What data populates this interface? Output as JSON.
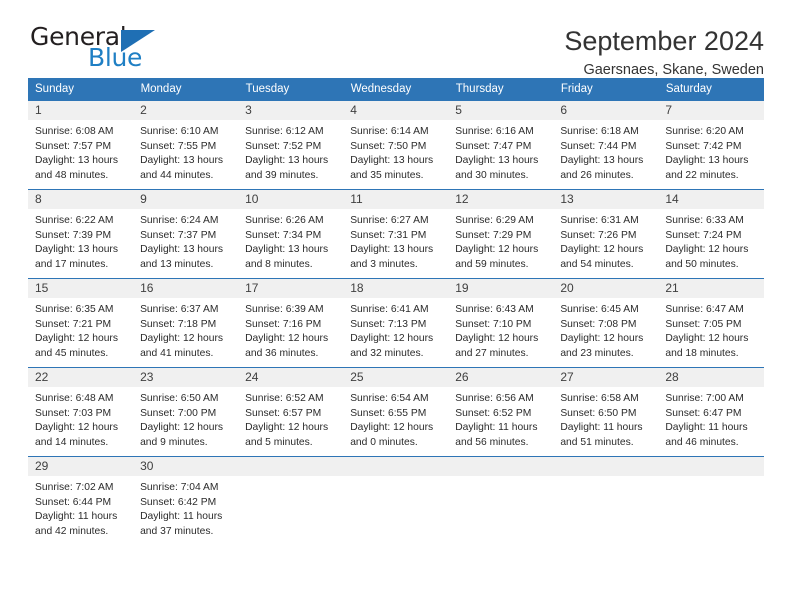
{
  "logo": {
    "word_top": "General",
    "word_bottom": "Blue",
    "triangle_color": "#1f6fb4",
    "top_color": "#231f20",
    "bottom_color": "#1f7fc4"
  },
  "header": {
    "title": "September 2024",
    "subtitle": "Gaersnaes, Skane, Sweden"
  },
  "theme": {
    "header_bg": "#2e75b6",
    "header_text": "#ffffff",
    "daynum_bg": "#f0f0f0",
    "grid_line": "#2e75b6"
  },
  "weekday_headers": [
    "Sunday",
    "Monday",
    "Tuesday",
    "Wednesday",
    "Thursday",
    "Friday",
    "Saturday"
  ],
  "labels": {
    "sunrise": "Sunrise:",
    "sunset": "Sunset:",
    "daylight": "Daylight:"
  },
  "weeks": [
    [
      {
        "day": "1",
        "sunrise": "Sunrise: 6:08 AM",
        "sunset": "Sunset: 7:57 PM",
        "daylight_line1": "Daylight: 13 hours",
        "daylight_line2": "and 48 minutes."
      },
      {
        "day": "2",
        "sunrise": "Sunrise: 6:10 AM",
        "sunset": "Sunset: 7:55 PM",
        "daylight_line1": "Daylight: 13 hours",
        "daylight_line2": "and 44 minutes."
      },
      {
        "day": "3",
        "sunrise": "Sunrise: 6:12 AM",
        "sunset": "Sunset: 7:52 PM",
        "daylight_line1": "Daylight: 13 hours",
        "daylight_line2": "and 39 minutes."
      },
      {
        "day": "4",
        "sunrise": "Sunrise: 6:14 AM",
        "sunset": "Sunset: 7:50 PM",
        "daylight_line1": "Daylight: 13 hours",
        "daylight_line2": "and 35 minutes."
      },
      {
        "day": "5",
        "sunrise": "Sunrise: 6:16 AM",
        "sunset": "Sunset: 7:47 PM",
        "daylight_line1": "Daylight: 13 hours",
        "daylight_line2": "and 30 minutes."
      },
      {
        "day": "6",
        "sunrise": "Sunrise: 6:18 AM",
        "sunset": "Sunset: 7:44 PM",
        "daylight_line1": "Daylight: 13 hours",
        "daylight_line2": "and 26 minutes."
      },
      {
        "day": "7",
        "sunrise": "Sunrise: 6:20 AM",
        "sunset": "Sunset: 7:42 PM",
        "daylight_line1": "Daylight: 13 hours",
        "daylight_line2": "and 22 minutes."
      }
    ],
    [
      {
        "day": "8",
        "sunrise": "Sunrise: 6:22 AM",
        "sunset": "Sunset: 7:39 PM",
        "daylight_line1": "Daylight: 13 hours",
        "daylight_line2": "and 17 minutes."
      },
      {
        "day": "9",
        "sunrise": "Sunrise: 6:24 AM",
        "sunset": "Sunset: 7:37 PM",
        "daylight_line1": "Daylight: 13 hours",
        "daylight_line2": "and 13 minutes."
      },
      {
        "day": "10",
        "sunrise": "Sunrise: 6:26 AM",
        "sunset": "Sunset: 7:34 PM",
        "daylight_line1": "Daylight: 13 hours",
        "daylight_line2": "and 8 minutes."
      },
      {
        "day": "11",
        "sunrise": "Sunrise: 6:27 AM",
        "sunset": "Sunset: 7:31 PM",
        "daylight_line1": "Daylight: 13 hours",
        "daylight_line2": "and 3 minutes."
      },
      {
        "day": "12",
        "sunrise": "Sunrise: 6:29 AM",
        "sunset": "Sunset: 7:29 PM",
        "daylight_line1": "Daylight: 12 hours",
        "daylight_line2": "and 59 minutes."
      },
      {
        "day": "13",
        "sunrise": "Sunrise: 6:31 AM",
        "sunset": "Sunset: 7:26 PM",
        "daylight_line1": "Daylight: 12 hours",
        "daylight_line2": "and 54 minutes."
      },
      {
        "day": "14",
        "sunrise": "Sunrise: 6:33 AM",
        "sunset": "Sunset: 7:24 PM",
        "daylight_line1": "Daylight: 12 hours",
        "daylight_line2": "and 50 minutes."
      }
    ],
    [
      {
        "day": "15",
        "sunrise": "Sunrise: 6:35 AM",
        "sunset": "Sunset: 7:21 PM",
        "daylight_line1": "Daylight: 12 hours",
        "daylight_line2": "and 45 minutes."
      },
      {
        "day": "16",
        "sunrise": "Sunrise: 6:37 AM",
        "sunset": "Sunset: 7:18 PM",
        "daylight_line1": "Daylight: 12 hours",
        "daylight_line2": "and 41 minutes."
      },
      {
        "day": "17",
        "sunrise": "Sunrise: 6:39 AM",
        "sunset": "Sunset: 7:16 PM",
        "daylight_line1": "Daylight: 12 hours",
        "daylight_line2": "and 36 minutes."
      },
      {
        "day": "18",
        "sunrise": "Sunrise: 6:41 AM",
        "sunset": "Sunset: 7:13 PM",
        "daylight_line1": "Daylight: 12 hours",
        "daylight_line2": "and 32 minutes."
      },
      {
        "day": "19",
        "sunrise": "Sunrise: 6:43 AM",
        "sunset": "Sunset: 7:10 PM",
        "daylight_line1": "Daylight: 12 hours",
        "daylight_line2": "and 27 minutes."
      },
      {
        "day": "20",
        "sunrise": "Sunrise: 6:45 AM",
        "sunset": "Sunset: 7:08 PM",
        "daylight_line1": "Daylight: 12 hours",
        "daylight_line2": "and 23 minutes."
      },
      {
        "day": "21",
        "sunrise": "Sunrise: 6:47 AM",
        "sunset": "Sunset: 7:05 PM",
        "daylight_line1": "Daylight: 12 hours",
        "daylight_line2": "and 18 minutes."
      }
    ],
    [
      {
        "day": "22",
        "sunrise": "Sunrise: 6:48 AM",
        "sunset": "Sunset: 7:03 PM",
        "daylight_line1": "Daylight: 12 hours",
        "daylight_line2": "and 14 minutes."
      },
      {
        "day": "23",
        "sunrise": "Sunrise: 6:50 AM",
        "sunset": "Sunset: 7:00 PM",
        "daylight_line1": "Daylight: 12 hours",
        "daylight_line2": "and 9 minutes."
      },
      {
        "day": "24",
        "sunrise": "Sunrise: 6:52 AM",
        "sunset": "Sunset: 6:57 PM",
        "daylight_line1": "Daylight: 12 hours",
        "daylight_line2": "and 5 minutes."
      },
      {
        "day": "25",
        "sunrise": "Sunrise: 6:54 AM",
        "sunset": "Sunset: 6:55 PM",
        "daylight_line1": "Daylight: 12 hours",
        "daylight_line2": "and 0 minutes."
      },
      {
        "day": "26",
        "sunrise": "Sunrise: 6:56 AM",
        "sunset": "Sunset: 6:52 PM",
        "daylight_line1": "Daylight: 11 hours",
        "daylight_line2": "and 56 minutes."
      },
      {
        "day": "27",
        "sunrise": "Sunrise: 6:58 AM",
        "sunset": "Sunset: 6:50 PM",
        "daylight_line1": "Daylight: 11 hours",
        "daylight_line2": "and 51 minutes."
      },
      {
        "day": "28",
        "sunrise": "Sunrise: 7:00 AM",
        "sunset": "Sunset: 6:47 PM",
        "daylight_line1": "Daylight: 11 hours",
        "daylight_line2": "and 46 minutes."
      }
    ],
    [
      {
        "day": "29",
        "sunrise": "Sunrise: 7:02 AM",
        "sunset": "Sunset: 6:44 PM",
        "daylight_line1": "Daylight: 11 hours",
        "daylight_line2": "and 42 minutes."
      },
      {
        "day": "30",
        "sunrise": "Sunrise: 7:04 AM",
        "sunset": "Sunset: 6:42 PM",
        "daylight_line1": "Daylight: 11 hours",
        "daylight_line2": "and 37 minutes."
      },
      {
        "day": "",
        "sunrise": "",
        "sunset": "",
        "daylight_line1": "",
        "daylight_line2": ""
      },
      {
        "day": "",
        "sunrise": "",
        "sunset": "",
        "daylight_line1": "",
        "daylight_line2": ""
      },
      {
        "day": "",
        "sunrise": "",
        "sunset": "",
        "daylight_line1": "",
        "daylight_line2": ""
      },
      {
        "day": "",
        "sunrise": "",
        "sunset": "",
        "daylight_line1": "",
        "daylight_line2": ""
      },
      {
        "day": "",
        "sunrise": "",
        "sunset": "",
        "daylight_line1": "",
        "daylight_line2": ""
      }
    ]
  ]
}
